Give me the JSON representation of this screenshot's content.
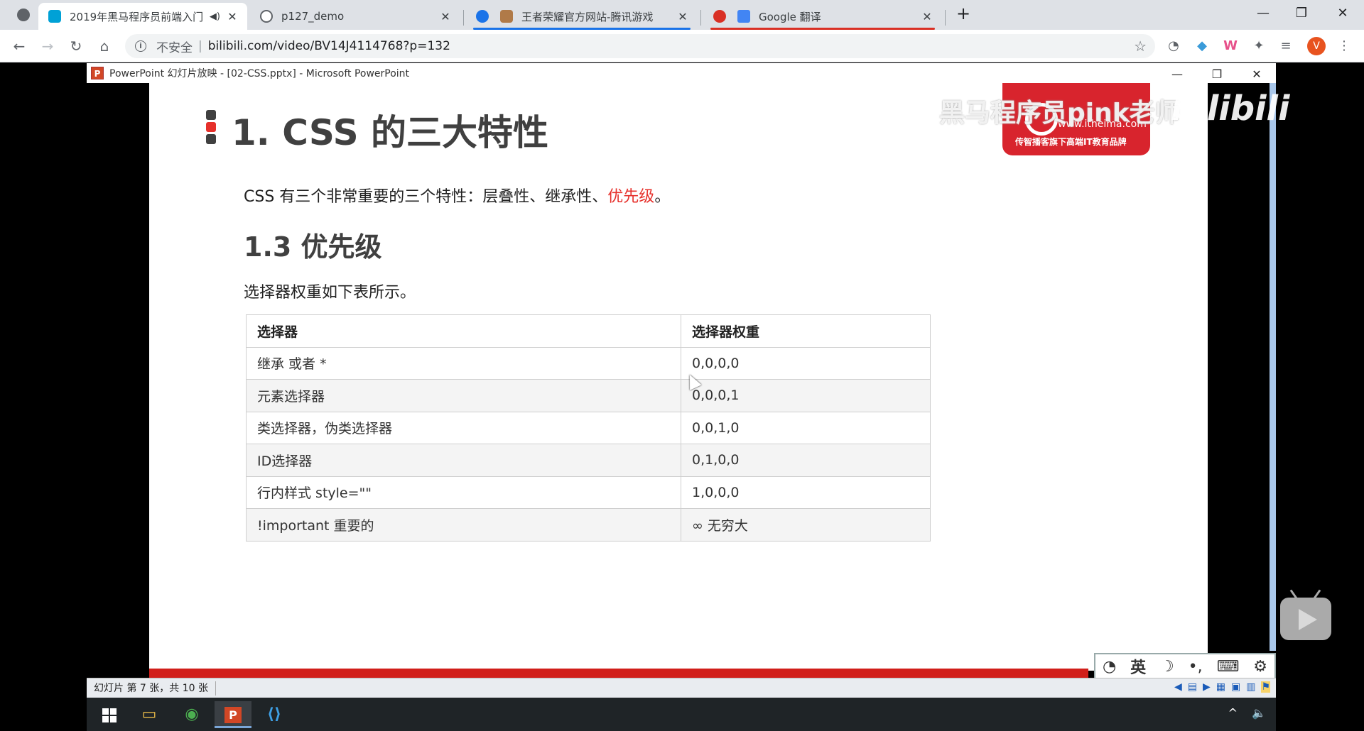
{
  "browser": {
    "tabs": [
      {
        "title": "2019年黑马程序员前端入门",
        "favicon_color": "#00a1d6",
        "active": true,
        "audio_icon": "speaker-icon"
      },
      {
        "title": "p127_demo",
        "favicon_color": "#5f6368",
        "active": false
      },
      {
        "title": "王者荣耀官方网站-腾讯游戏",
        "favicon_color": "#1a73e8",
        "active": false
      },
      {
        "title": "Google 翻译",
        "favicon_color": "#d93025",
        "active": false
      }
    ],
    "tab_close": "✕",
    "new_tab": "+",
    "window_controls": {
      "minimize": "—",
      "restore": "❐",
      "close": "✕"
    },
    "nav": {
      "back": "←",
      "forward": "→",
      "reload": "↻",
      "home": "⌂"
    },
    "address": {
      "info_icon": "i",
      "security_label": "不安全",
      "separator": "|",
      "url": "bilibili.com/video/BV14J4114768?p=132",
      "star": "☆"
    },
    "extensions": [
      "◔",
      "◆",
      "W",
      "✦",
      "≡"
    ],
    "profile_initial": "V",
    "menu": "⋮"
  },
  "ppt": {
    "window_title": "PowerPoint 幻灯片放映 - [02-CSS.pptx] - Microsoft PowerPoint",
    "logo_letter": "P",
    "window_controls": {
      "minimize": "—",
      "restore": "❐",
      "close": "✕"
    },
    "status_text": "幻灯片 第 7 张，共 10 张",
    "status_icons": [
      "◀",
      "▤",
      "▶",
      "▦",
      "▣",
      "▥",
      "⚑"
    ]
  },
  "slide": {
    "title": "1. CSS 的三大特性",
    "title_mark_colors": [
      "#404040",
      "#e6302b",
      "#404040"
    ],
    "intro_prefix": "CSS 有三个非常重要的三个特性：层叠性、继承性、",
    "intro_highlight": "优先级",
    "intro_suffix": "。",
    "subtitle": "1.3 优先级",
    "description": "选择器权重如下表所示。",
    "table": {
      "headers": [
        "选择器",
        "选择器权重"
      ],
      "rows": [
        [
          "继承 或者 *",
          "0,0,0,0"
        ],
        [
          "元素选择器",
          "0,0,0,1"
        ],
        [
          "类选择器，伪类选择器",
          "0,0,1,0"
        ],
        [
          "ID选择器",
          "0,1,0,0"
        ],
        [
          "行内样式 style=\"\"",
          "1,0,0,0"
        ],
        [
          "!important  重要的",
          "∞ 无穷大"
        ]
      ]
    },
    "brand_url": "www.itheima.com",
    "brand_slogan": "传智播客旗下高端IT教育品牌",
    "watermark": "黑马程序员pink老师",
    "bili_logo": "bilibili"
  },
  "ime": {
    "items": [
      "◔",
      "英",
      "☽",
      "•,",
      "⌨",
      "⚙"
    ]
  },
  "taskbar": {
    "items": [
      "start",
      "file-explorer",
      "chrome",
      "powerpoint",
      "vscode"
    ],
    "labels": {
      "explorer": "▭",
      "chrome": "◉",
      "powerpoint": "P",
      "vscode": "⟨⟩"
    },
    "tray": [
      "^",
      "🔈"
    ]
  },
  "colors": {
    "accent_red": "#d11f1a",
    "highlight_red": "#e6302b",
    "tab_underline_blue": "#1a73e8",
    "tab_underline_red": "#d93025"
  }
}
